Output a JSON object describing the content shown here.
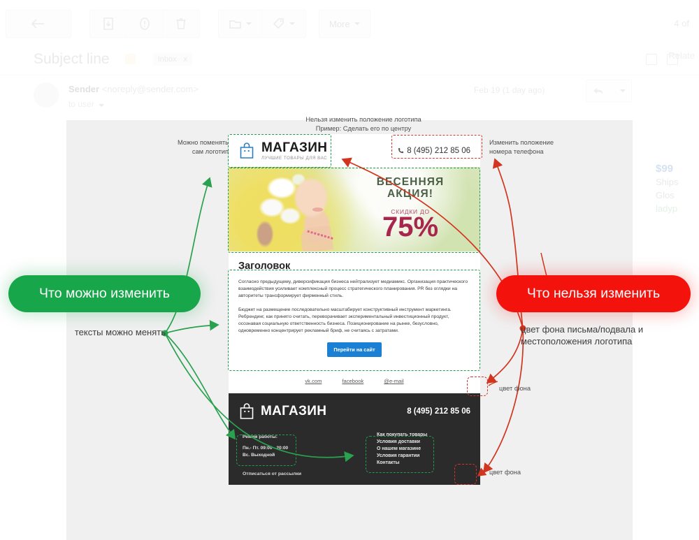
{
  "gmail": {
    "toolbar": {
      "back_icon": "back-arrow-icon",
      "archive_icon": "archive-icon",
      "spam_icon": "report-spam-icon",
      "delete_icon": "trash-icon",
      "move_icon": "folder-icon",
      "label_icon": "label-tag-icon",
      "more_label": "More",
      "count_label": "4 of"
    },
    "subject": "Subject line",
    "star_icon": "star-icon",
    "inbox_chip": "Inbox",
    "inbox_chip_close": "x",
    "print_icon": "print-icon",
    "popout_icon": "open-in-new-window-icon",
    "related_label": "Relate",
    "sender_name": "Sender",
    "sender_email": "<noreply@sender.com>",
    "to_line": "to user",
    "date": "Feb 19 (1 day ago)",
    "reply_icon": "reply-arrow-icon",
    "more_caret_icon": "chevron-down-icon"
  },
  "right_faded": {
    "price": "$99",
    "line1": "Ships",
    "line2": "Glos",
    "line3": "ladyp"
  },
  "email": {
    "logo": {
      "icon": "shopping-bag-icon",
      "name": "МАГАЗИН",
      "tagline": "ЛУЧШИЕ ТОВАРЫ ДЛЯ ВАС"
    },
    "header_phone": "8 (495) 212 85 06",
    "phone_icon": "phone-handset-icon",
    "hero": {
      "title": "ВЕСЕННЯЯ\nАКЦИЯ!",
      "title_line1": "ВЕСЕННЯЯ",
      "title_line2": "АКЦИЯ!",
      "subtitle": "СКИДКИ ДО",
      "discount": "75%"
    },
    "body": {
      "heading": "Заголовок",
      "paragraph1": "Согласно предыдущему, диверсификация бизнеса нейтрализует медиамикс. Организация практического взаимодействия усиливает комплексный процесс стратегического планирования. PR без оглядки на авторитеты трансформирует фирменный стиль.",
      "paragraph2": "Бюджет на размещение последовательно масштабирует конструктивный инструмент маркетинга. Ребрендинг, как принято считать, переворачивает экспериментальный инвестиционный продукт, осознавая социальную ответственность бизнеса. Позиционирование на рынке, безусловно, одновременно концентрирует рекламный бриф, не считаясь с затратами.",
      "cta_label": "Перейти на сайт"
    },
    "social_links": [
      "vk.com",
      "facebook",
      "@e-mail"
    ],
    "footer": {
      "logo_icon": "shopping-bag-icon",
      "logo_name": "МАГАЗИН",
      "phone": "8 (495) 212 85 06",
      "hours_title": "Режим работы:",
      "hours_line1": "Пн.- Пт. 09:00 - 20:00",
      "hours_line2": "Вс. Выходной",
      "menu": [
        "Как покупать товары",
        "Условия доставки",
        "О нашем магазине",
        "Условия гарантии",
        "Контакты"
      ],
      "unsubscribe": "Отписаться от рассылки"
    }
  },
  "annotations": {
    "pill_green": "Что можно изменить",
    "pill_red": "Что нельзя изменить",
    "top_line1": "Нельзя изменить положение логотипа",
    "top_line2": "Пример: Сделать его  по центру",
    "left_logo_line1": "Можно поменять",
    "left_logo_line2": "сам логотип",
    "right_phone_line1": "Изменить положение",
    "right_phone_line2": "номера телефона",
    "texts_editable": "тексты можно менять",
    "bg_color_note_line1": "цвет фона письма/подвала и",
    "bg_color_note_line2": "местоположения логотипа",
    "bg_label_1": "цвет фона",
    "bg_label_2": "цвет фона"
  },
  "colors": {
    "green": "#17a64a",
    "red": "#f4120c",
    "dash_green": "#1f9c4c",
    "dash_red": "#d6322c",
    "cta_blue": "#1b7fd4",
    "footer_bg": "#2b2b2b",
    "canvas_bg": "#f0f0f0"
  }
}
